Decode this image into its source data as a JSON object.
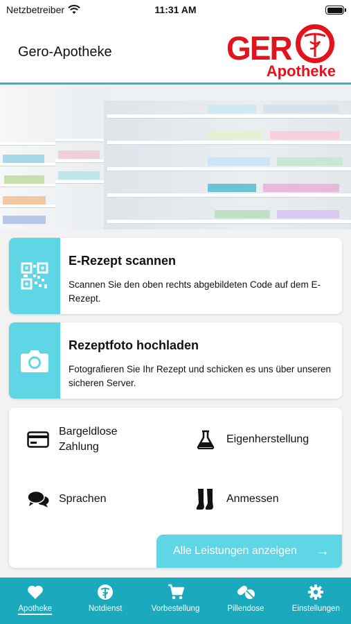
{
  "status_bar": {
    "carrier": "Netzbetreiber",
    "time": "11:31 AM"
  },
  "header": {
    "title": "Gero-Apotheke",
    "logo_main": "GER",
    "logo_sub": "Apotheke"
  },
  "cards": [
    {
      "title": "E-Rezept scannen",
      "text": "Scannen Sie den oben rechts abgebildeten Code auf dem E-Rezept.",
      "icon": "qr-code-icon"
    },
    {
      "title": "Rezeptfoto hochladen",
      "text": "Fotografieren Sie Ihr Rezept und schicken es uns über unseren sicheren Server.",
      "icon": "camera-icon"
    }
  ],
  "services": {
    "items": [
      {
        "label": "Bargeldlose Zahlung",
        "icon": "credit-card-icon"
      },
      {
        "label": "Eigenherstellung",
        "icon": "flask-icon"
      },
      {
        "label": "Sprachen",
        "icon": "speech-bubbles-icon"
      },
      {
        "label": "Anmessen",
        "icon": "stockings-icon"
      }
    ],
    "all_label": "Alle Leistungen anzeigen"
  },
  "tabs": [
    {
      "label": "Apotheke",
      "icon": "heart-icon",
      "active": true
    },
    {
      "label": "Notdienst",
      "icon": "caduceus-icon",
      "active": false
    },
    {
      "label": "Vorbestellung",
      "icon": "cart-icon",
      "active": false
    },
    {
      "label": "Pillendose",
      "icon": "pill-icon",
      "active": false
    },
    {
      "label": "Einstellungen",
      "icon": "gear-icon",
      "active": false
    }
  ],
  "colors": {
    "accent": "#1aa9bd",
    "card_icon_bg": "#5fd6e6",
    "brand_red": "#e3131b"
  }
}
